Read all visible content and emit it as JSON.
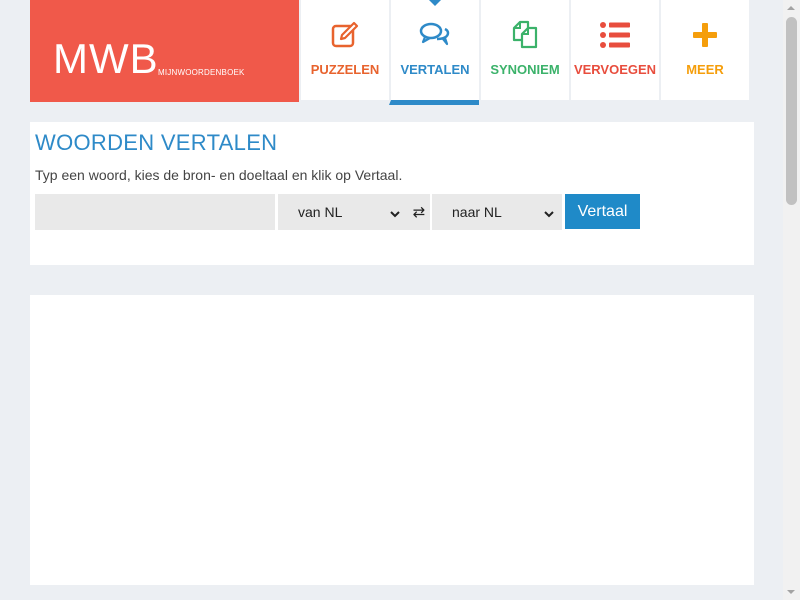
{
  "logo": {
    "title": "MWB",
    "subtitle": "MIJNWOORDENBOEK",
    "color": "#f0594a"
  },
  "nav": [
    {
      "label": "PUZZELEN",
      "icon": "pencil-square-icon",
      "color": "#e8632e"
    },
    {
      "label": "VERTALEN",
      "icon": "chat-bubbles-icon",
      "color": "#2e8ac8",
      "active": true
    },
    {
      "label": "SYNONIEM",
      "icon": "copy-icon",
      "color": "#3bb26a"
    },
    {
      "label": "VERVOEGEN",
      "icon": "list-icon",
      "color": "#e84d3d"
    },
    {
      "label": "MEER",
      "icon": "plus-icon",
      "color": "#f59e0b"
    }
  ],
  "translate": {
    "title": "WOORDEN VERTALEN",
    "description": "Typ een woord, kies de bron- en doeltaal en klik op Vertaal.",
    "word_placeholder": "",
    "from_value": "van NL",
    "swap_icon": "swap-arrows-icon",
    "to_value": "naar NL",
    "button_label": "Vertaal"
  }
}
